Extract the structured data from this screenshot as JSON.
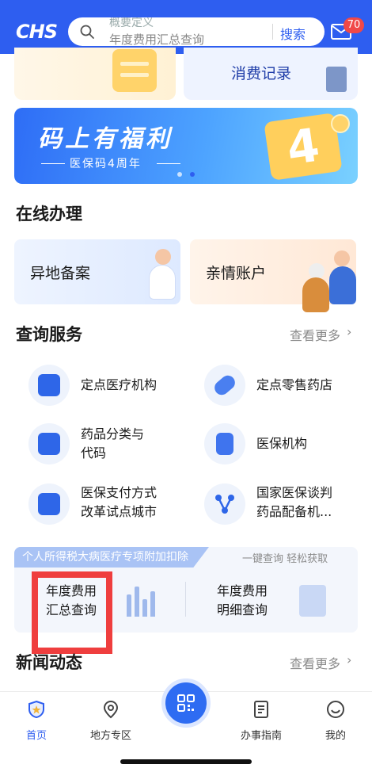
{
  "header": {
    "logo": "CHS",
    "search_hint_top": "概要定义",
    "search_placeholder": "年度费用汇总查询",
    "search_button": "搜索",
    "mail_badge": "70"
  },
  "top_cards": {
    "right_label": "消费记录"
  },
  "banner": {
    "title": "码上有福利",
    "subtitle": "医保码4周年",
    "badge_number": "4",
    "dots": 2,
    "active_dot": 1
  },
  "online": {
    "title": "在线办理",
    "cards": [
      {
        "label": "异地备案"
      },
      {
        "label": "亲情账户"
      }
    ]
  },
  "query": {
    "title": "查询服务",
    "more": "查看更多",
    "items": [
      {
        "line1": "定点医疗机构",
        "line2": ""
      },
      {
        "line1": "定点零售药店",
        "line2": ""
      },
      {
        "line1": "药品分类与",
        "line2": "代码"
      },
      {
        "line1": "医保机构",
        "line2": ""
      },
      {
        "line1": "医保支付方式",
        "line2": "改革试点城市"
      },
      {
        "line1": "国家医保谈判",
        "line2": "药品配备机..."
      }
    ]
  },
  "tax": {
    "tag": "个人所得税大病医疗专项附加扣除",
    "right_text": "一键查询 轻松获取",
    "items": [
      {
        "line1": "年度费用",
        "line2": "汇总查询"
      },
      {
        "line1": "年度费用",
        "line2": "明细查询"
      }
    ]
  },
  "news": {
    "title": "新闻动态",
    "more": "查看更多"
  },
  "tabbar": {
    "tabs": [
      {
        "label": "首页",
        "icon": "shield-home-icon",
        "active": true
      },
      {
        "label": "地方专区",
        "icon": "location-pin-icon",
        "active": false
      },
      {
        "label": "办事指南",
        "icon": "document-icon",
        "active": false
      },
      {
        "label": "我的",
        "icon": "smiley-face-icon",
        "active": false
      }
    ],
    "center_icon": "qr-code-icon"
  },
  "colors": {
    "primary": "#2e5ef0",
    "badge": "#f04848",
    "highlight_box": "#ef3e3e"
  }
}
